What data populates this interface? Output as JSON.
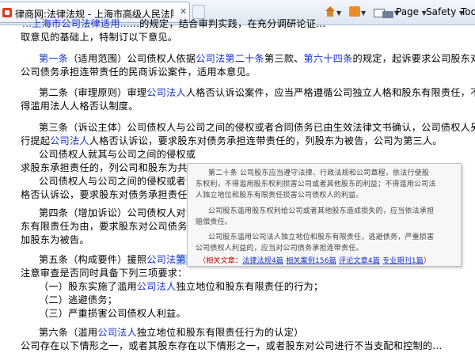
{
  "browser": {
    "tab_title": "律商网:法律法规 - 上海市高级人民法院民二庭关...",
    "tab_close": "✕",
    "page_menu": "Page",
    "safety_menu": "Safety",
    "tools_menu": "Tools"
  },
  "document": {
    "line_top_a": "...上海市公司法律适用...",
    "line_top_b": "...的规定，结合审判实践，在充分调研论证...",
    "line_1": "取意见的基础上，特制订以下意见。",
    "art1": {
      "a": "第一条",
      "b": "（适用范围）公司债权人依据",
      "c": "公司法",
      "d": "第二十条",
      "e": "第三款、",
      "f": "第六十四条",
      "g": "的规定，起诉要求公司股东对",
      "line2": "公司债务承担连带责任的民商诉讼案件，适用本意见。"
    },
    "art2": {
      "a": "第二条（审理原则）审理",
      "b": "公司法人",
      "c": "人格否认诉讼案件，应当严格遵循公司独立人格和股东有限责任，不",
      "line2": "得滥用法人人格否认制度。"
    },
    "art3": {
      "a": "第三条（诉讼主体）公司债权人与公司之间的侵权或者合同债务已由生效法律文书确认，公司债权人另",
      "b": "行提起",
      "c": "公司法人",
      "d": "人格否认诉讼，要求股东对债务承担连带责任的，列股东为被告，公司为第三人。",
      "line3": "公司债权人就其与公司之间的侵权或",
      "line4": "求股东承担责任的，列公司和股东为共",
      "line5": "公司债权人与公司之间的侵权或者合",
      "line6": "格否认诉讼，要求股东对债务承担责任"
    },
    "art4": {
      "line1": "第四条（增加诉讼）公司债权人对公",
      "line2": "东有限责任为由，要求股东对公司债务承",
      "line3": "加股东为被告。"
    },
    "art5": {
      "a": "第五条（构成要件）援照",
      "b": "公司法",
      "c": "第二十",
      "line2": "注意审查是否同时具备下列三项要求：",
      "item1a": "（一）股东实施了滥用",
      "item1b": "公司法人",
      "item1c": "独立地位和股东有限责任的行为；",
      "item2": "（二）逃避债务；",
      "item3": "（三）严重损害公司债权人利益。"
    },
    "art6": {
      "a": "第六条（滥用",
      "b": "公司法人",
      "c": "独立地位和股东有限责任行为的认定）",
      "line2": "公司存在以下情形之一，或者其股东存在以下情形之一，或者股东对公司进行不当支配和控制的..."
    }
  },
  "popup": {
    "p1": "第二十条  公司股东应当遵守法律、行政法规和公司章程，依法行使股",
    "p2": "东权利，不得滥用股东权利损害公司或者其他股东的利益；不得滥用公司法",
    "p3": "人独立地位和股东有限责任损害公司债权人的利益。",
    "p4": "公司股东滥用股东权利给公司或者其他股东造成损失的，应当依法承担",
    "p5": "赔偿责任。",
    "p6": "公司股东滥用公司法人独立地位和股东有限责任，逃避债务，严重损害",
    "p7": "公司债权人利益的，应当对公司债务承担连带责任。",
    "related_label": "（相关文章：",
    "link1": "法律法规4篇",
    "link2": "相关案例156篇",
    "link3": "评论文章4篇",
    "link4": "专业期刊1篇",
    "close_paren": "）"
  }
}
